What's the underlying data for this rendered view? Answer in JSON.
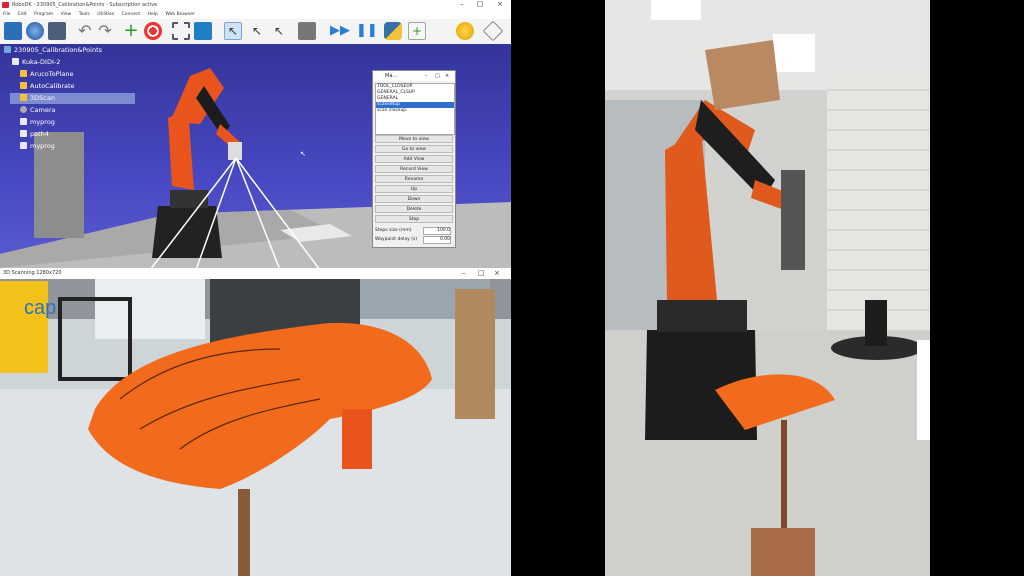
{
  "robodk": {
    "title": "RoboDK - 230905_Calibration&Points - Subscription active",
    "menu": [
      "File",
      "Edit",
      "Program",
      "View",
      "Tools",
      "Utilities",
      "Connect",
      "Help",
      "Web Browser"
    ],
    "tree": [
      {
        "label": "230905_Calibration&Points",
        "icon": "station-icon",
        "color": "#6fa8dc"
      },
      {
        "label": "Kuka-DIDI-2",
        "icon": "robot-icon",
        "color": "#e8e8e8"
      },
      {
        "label": "ArucoToPlane",
        "icon": "python-script-icon",
        "color": "#f3c13a"
      },
      {
        "label": "AutoCalibrate",
        "icon": "python-script-icon",
        "color": "#f3c13a"
      },
      {
        "label": "3DScan",
        "icon": "python-script-icon",
        "color": "#f3c13a",
        "selected": true
      },
      {
        "label": "Camera",
        "icon": "camera-icon",
        "color": "#aaaaaa"
      },
      {
        "label": "myprog",
        "icon": "program-icon",
        "color": "#e8e8e8"
      },
      {
        "label": "path4",
        "icon": "program-icon",
        "color": "#e8e8e8"
      },
      {
        "label": "myprog",
        "icon": "program-icon",
        "color": "#e8e8e8"
      }
    ],
    "colors": {
      "background_top": "#34349b",
      "background_bottom": "#5a5ad0",
      "robot": "#e8541c",
      "selected": "#7f8bd1"
    }
  },
  "dialog": {
    "title": "Ma...",
    "list": [
      "TOOL_CLOSEUP",
      "GENERAL_CLSUP",
      "GENERAL",
      "scansetup",
      "scan closeup"
    ],
    "selected_index": 3,
    "buttons": [
      "Move to view",
      "Go to view",
      "Add View",
      "Record View",
      "Rename",
      "Up",
      "Down",
      "Delete",
      "Stop"
    ],
    "step_label": "Steps size (mm)",
    "step_value": "100.0",
    "delay_label": "Waypoint delay (s)",
    "delay_value": "0.00"
  },
  "scan": {
    "title": "3D Scanning 1280x720",
    "sign_text": "cap",
    "colors": {
      "part": "#f26a1b",
      "stand": "#8a5a3a"
    }
  }
}
